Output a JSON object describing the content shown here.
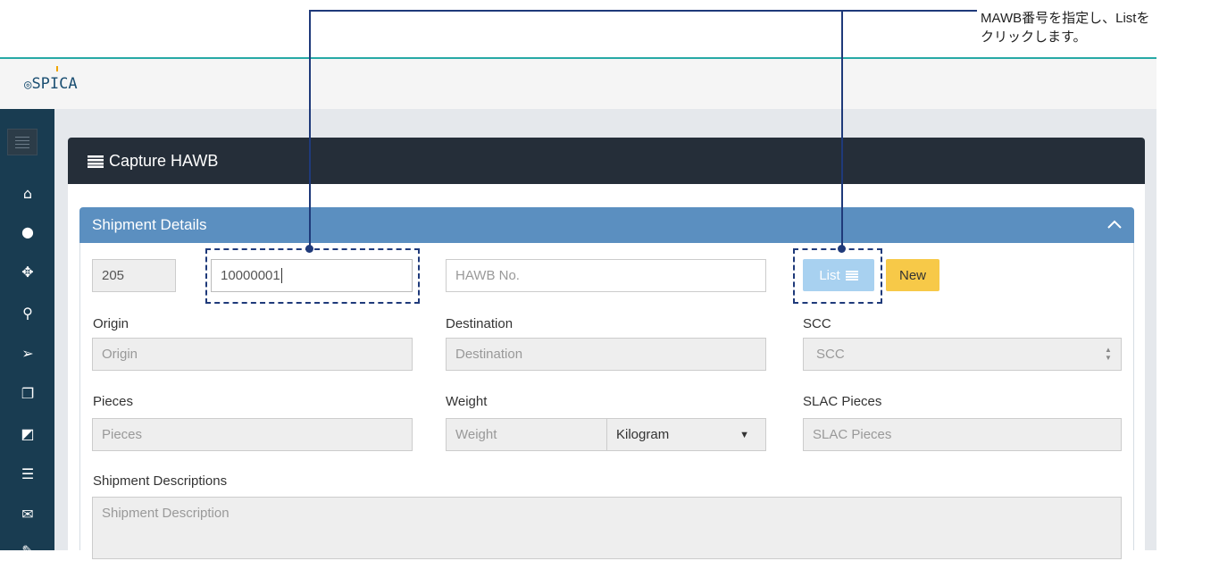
{
  "annotation": {
    "line1": "MAWB番号を指定し、Listを",
    "line2": "クリックします。"
  },
  "app": {
    "logo": "SPICA"
  },
  "sidebar": {
    "icons": [
      "home-icon",
      "user-icon",
      "move-icon",
      "search-icon",
      "send-icon",
      "copy-icon",
      "external-link-icon",
      "list-icon",
      "envelope-icon",
      "edit-icon"
    ]
  },
  "panel": {
    "title": "Capture HAWB"
  },
  "section": {
    "title": "Shipment Details"
  },
  "form": {
    "prefix_value": "205",
    "mawb_value": "10000001",
    "hawb_placeholder": "HAWB No.",
    "list_label": "List",
    "new_label": "New",
    "origin_label": "Origin",
    "origin_placeholder": "Origin",
    "destination_label": "Destination",
    "destination_placeholder": "Destination",
    "scc_label": "SCC",
    "scc_placeholder": "SCC",
    "pieces_label": "Pieces",
    "pieces_placeholder": "Pieces",
    "weight_label": "Weight",
    "weight_placeholder": "Weight",
    "weight_unit": "Kilogram",
    "slac_label": "SLAC Pieces",
    "slac_placeholder": "SLAC Pieces",
    "desc_label": "Shipment Descriptions",
    "desc_placeholder": "Shipment Description"
  },
  "colors": {
    "sidebar": "#193c51",
    "panel_header": "#252e39",
    "section_header": "#5b8fc0",
    "list_button": "#a8d1f0",
    "new_button": "#f7c948",
    "annotation": "#1f3a7a",
    "accent_line": "#27a9a6"
  }
}
